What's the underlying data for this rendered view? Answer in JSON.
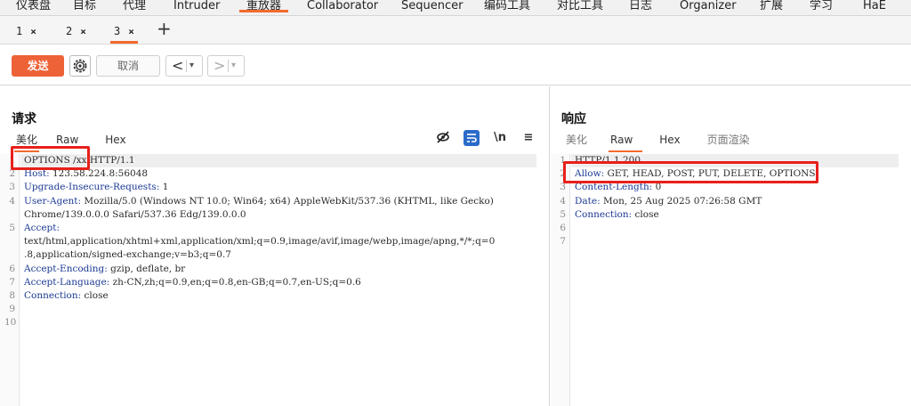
{
  "menu": {
    "items": [
      "仪表盘",
      "目标",
      "代理",
      "Intruder",
      "重放器",
      "Collaborator",
      "Sequencer",
      "编码工具",
      "对比工具",
      "日志",
      "Organizer",
      "扩展",
      "学习",
      "HaE"
    ],
    "active_index": 4
  },
  "tabs": {
    "items": [
      {
        "label": "1",
        "close": "×"
      },
      {
        "label": "2",
        "close": "×"
      },
      {
        "label": "3",
        "close": "×"
      }
    ],
    "active_index": 2,
    "add": "+"
  },
  "toolbar": {
    "send_label": "发送",
    "cancel_label": "取消",
    "prev_arrow": "<",
    "next_arrow": ">",
    "dropdown": "▾"
  },
  "request": {
    "title": "请求",
    "subtabs": [
      "美化",
      "Raw",
      "Hex"
    ],
    "active_subtab": 0,
    "lines": [
      {
        "n": "1",
        "key": "",
        "value": "OPTIONS /xx HTTP/1.1"
      },
      {
        "n": "2",
        "key": "Host",
        "value": "123.58.224.8:56048"
      },
      {
        "n": "3",
        "key": "Upgrade-Insecure-Requests",
        "value": "1"
      },
      {
        "n": "4",
        "key": "User-Agent",
        "value": "Mozilla/5.0 (Windows NT 10.0; Win64; x64) AppleWebKit/537.36 (KHTML, like Gecko)"
      },
      {
        "n": "",
        "key": "",
        "value": "Chrome/139.0.0.0 Safari/537.36 Edg/139.0.0.0"
      },
      {
        "n": "5",
        "key": "Accept",
        "value": ""
      },
      {
        "n": "",
        "key": "",
        "value": "text/html,application/xhtml+xml,application/xml;q=0.9,image/avif,image/webp,image/apng,*/*;q=0"
      },
      {
        "n": "",
        "key": "",
        "value": ".8,application/signed-exchange;v=b3;q=0.7"
      },
      {
        "n": "6",
        "key": "Accept-Encoding",
        "value": "gzip, deflate, br"
      },
      {
        "n": "7",
        "key": "Accept-Language",
        "value": "zh-CN,zh;q=0.9,en;q=0.8,en-GB;q=0.7,en-US;q=0.6"
      },
      {
        "n": "8",
        "key": "Connection",
        "value": "close"
      },
      {
        "n": "9",
        "key": "",
        "value": ""
      },
      {
        "n": "10",
        "key": "",
        "value": ""
      }
    ]
  },
  "response": {
    "title": "响应",
    "subtabs": [
      "美化",
      "Raw",
      "Hex",
      "页面渲染"
    ],
    "active_subtab": 1,
    "lines": [
      {
        "n": "1",
        "key": "",
        "value": "HTTP/1.1 200"
      },
      {
        "n": "2",
        "key": "Allow",
        "value": "GET, HEAD, POST, PUT, DELETE, OPTIONS"
      },
      {
        "n": "3",
        "key": "Content-Length",
        "value": "0"
      },
      {
        "n": "4",
        "key": "Date",
        "value": "Mon, 25 Aug 2025 07:26:58 GMT"
      },
      {
        "n": "5",
        "key": "Connection",
        "value": "close"
      },
      {
        "n": "6",
        "key": "",
        "value": ""
      },
      {
        "n": "7",
        "key": "",
        "value": ""
      }
    ]
  },
  "editor_icons": [
    "eye-slash-icon",
    "wrap-icon",
    "newline-icon",
    "menu-icon"
  ],
  "colors": {
    "accent": "#ed6236",
    "highlight_box": "#e8201a",
    "header_key": "#1b3a94"
  }
}
